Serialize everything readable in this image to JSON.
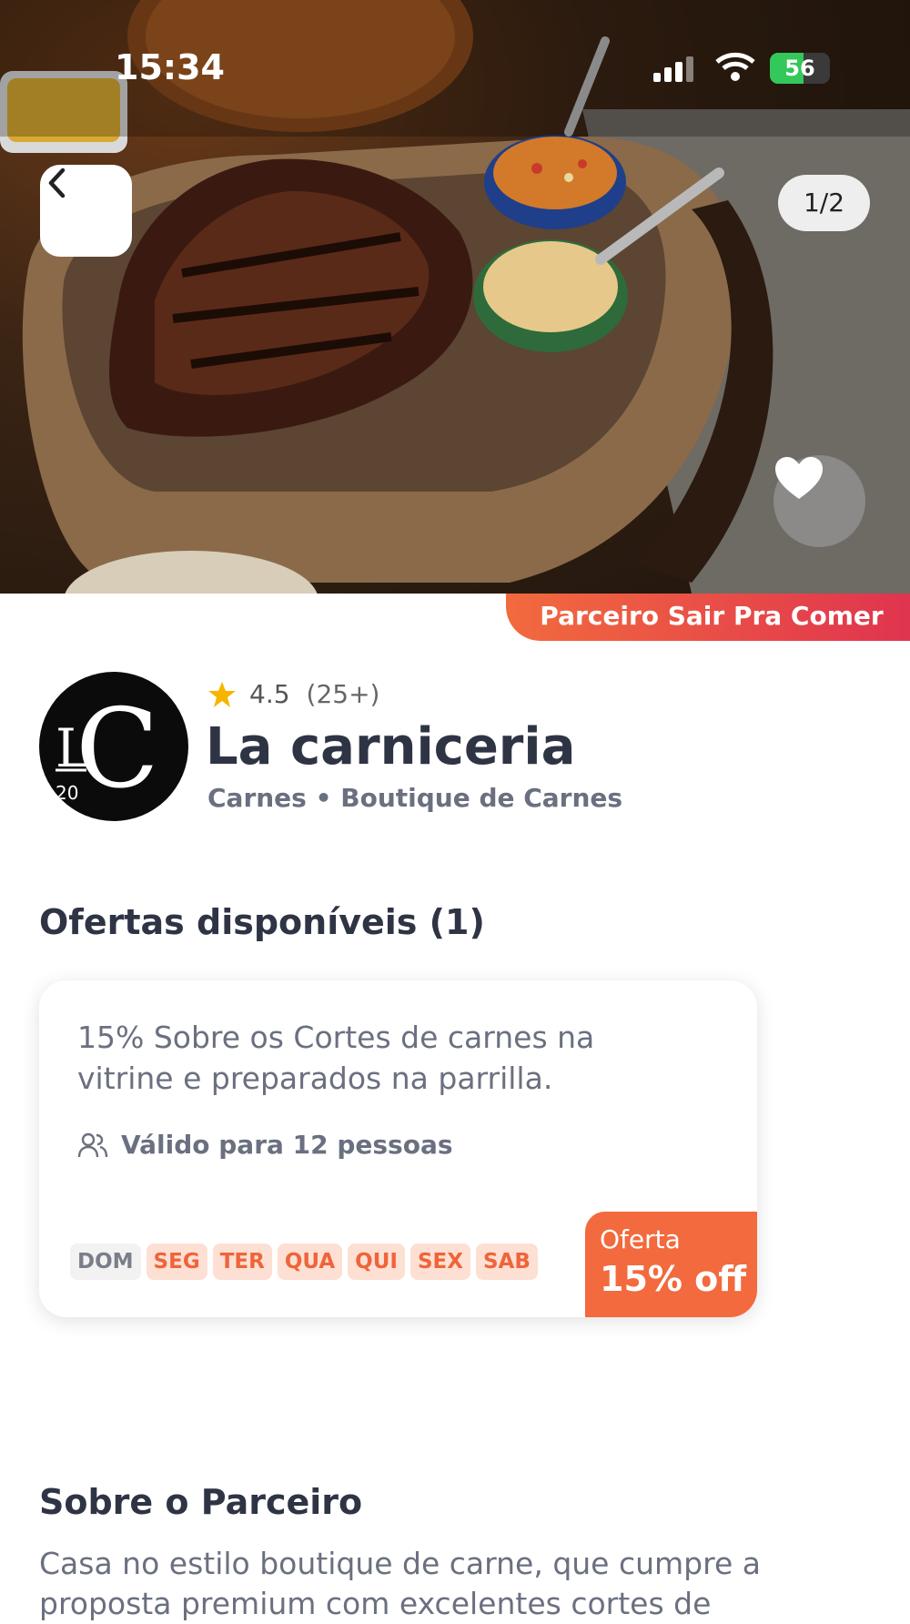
{
  "status_bar": {
    "time": "15:34",
    "battery": "56",
    "battery_level": 0.56
  },
  "gallery": {
    "counter": "1/2"
  },
  "partner_badge": "Parceiro Sair Pra Comer",
  "restaurant": {
    "logo_text": "LC",
    "logo_number": "20",
    "rating": "4.5",
    "rating_count": "(25+)",
    "name": "La carniceria",
    "categories": "Carnes • Boutique de Carnes"
  },
  "offers": {
    "heading": "Ofertas disponíveis (1)",
    "items": [
      {
        "description": "15% Sobre os Cortes de carnes na vitrine e preparados na parrilla.",
        "valid": "Válido para 12 pessoas",
        "days": [
          "DOM",
          "SEG",
          "TER",
          "QUA",
          "QUI",
          "SEX",
          "SAB"
        ],
        "tag_label": "Oferta",
        "tag_value": "15% off"
      }
    ]
  },
  "about": {
    "heading": "Sobre o Parceiro",
    "text": "Casa no estilo boutique de carne, que cumpre a proposta premium com excelentes cortes de"
  },
  "colors": {
    "accent": "#f26a3e",
    "accent_end": "#e0344f",
    "star": "#f7b500",
    "text_dark": "#2f3445",
    "text_muted": "#6b7080"
  }
}
